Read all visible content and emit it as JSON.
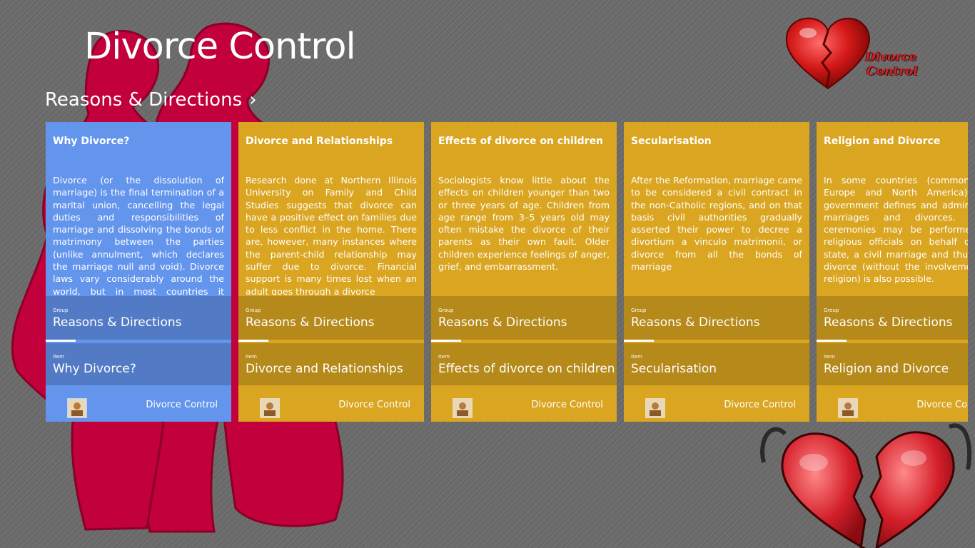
{
  "app": {
    "title": "Divorce Control"
  },
  "logo": {
    "line1": "Divorce",
    "line2": "Control"
  },
  "group_header": {
    "label": "Reasons & Directions",
    "chevron": "›"
  },
  "labels": {
    "group_caption": "Group",
    "item_caption": "Item"
  },
  "tiles": [
    {
      "title": "Why Divorce?",
      "body": "Divorce (or the dissolution of marriage) is the final termination of a marital union, cancelling the legal duties and responsibilities of marriage and dissolving the bonds of matrimony between the parties (unlike annulment, which declares the marriage null and void). Divorce laws vary considerably around the world, but in most countries it requires the sanction of a court or other",
      "group": "Reasons & Directions",
      "item": "Why Divorce?",
      "app_name": "Divorce Control",
      "color": "#6495ed",
      "thumb_icon": "handshake-icon"
    },
    {
      "title": "Divorce and Relationships",
      "body": "Research done at Northern Illinois University on Family and Child Studies suggests that divorce can have a positive effect on families due to less conflict in the home. There are, however, many instances where the parent-child relationship may suffer due to divorce. Financial support is many times lost when an adult goes through a divorce",
      "group": "Reasons & Directions",
      "item": "Divorce and Relationships",
      "app_name": "Divorce Control",
      "color": "#daa520",
      "thumb_icon": "wedding-cake-icon"
    },
    {
      "title": "Effects of divorce on children",
      "body": "Sociologists know little about the effects on children younger than two or three years of age. Children from age range from 3–5 years old may often mistake the divorce of their parents as their own fault. Older children experience feelings of anger, grief, and embarrassment.",
      "group": "Reasons & Directions",
      "item": "Effects of divorce on children",
      "app_name": "Divorce Control",
      "color": "#daa520",
      "thumb_icon": "family-icon"
    },
    {
      "title": "Secularisation",
      "body": "After the Reformation, marriage came to be considered a civil contract in the non-Catholic regions, and on that basis civil authorities gradually asserted their power to decree a divortium a vinculo matrimonii, or divorce from all the bonds of marriage",
      "group": "Reasons & Directions",
      "item": "Secularisation",
      "app_name": "Divorce Control",
      "color": "#daa520",
      "thumb_icon": "couple-icon"
    },
    {
      "title": "Religion and Divorce",
      "body": "In some countries (commonly in Europe and North America), the government defines and administers marriages and divorces. While ceremonies may be performed by religious officials on behalf of the state, a civil marriage and thus civil divorce (without the involvement of religion) is also possible.",
      "group": "Reasons & Directions",
      "item": "Religion and Divorce",
      "app_name": "Divorce Control",
      "color": "#daa520",
      "thumb_icon": "church-icon"
    }
  ]
}
